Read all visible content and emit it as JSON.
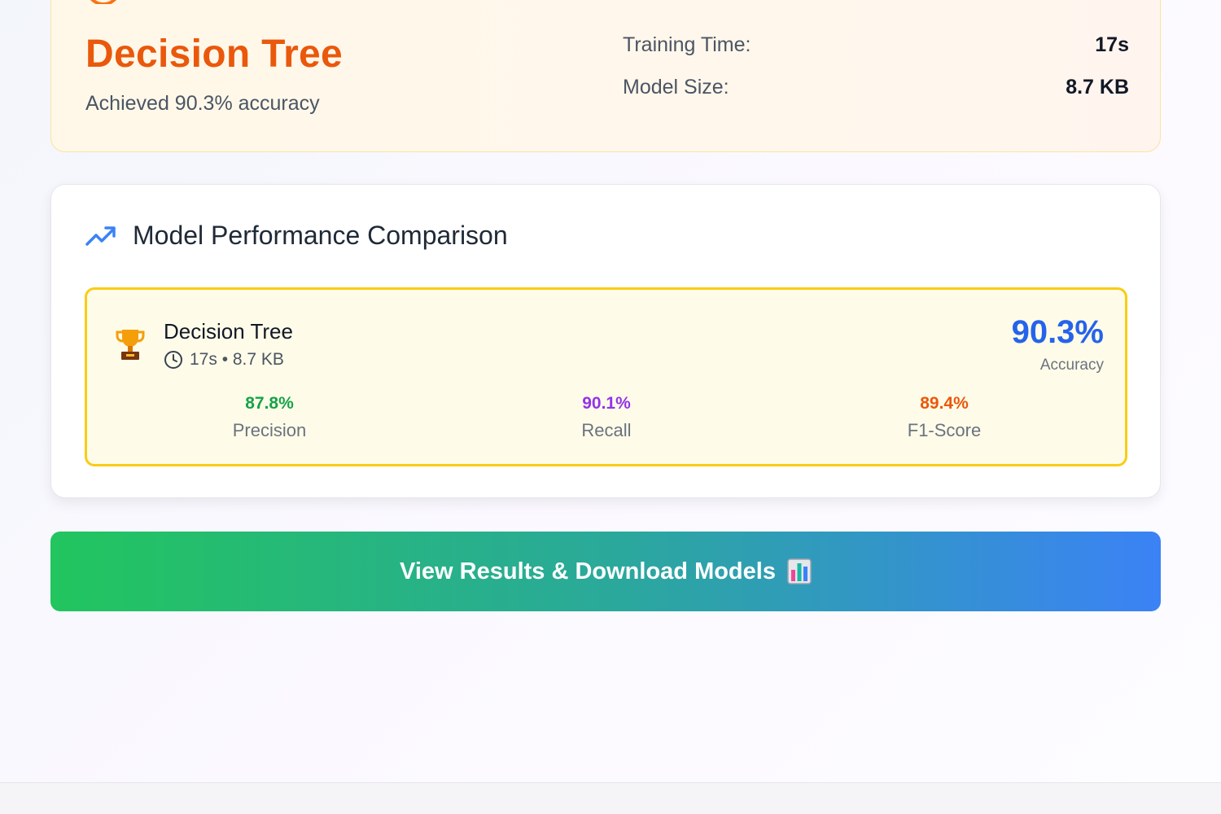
{
  "best_model": {
    "title": "Decision Tree",
    "subtitle": "Achieved 90.3% accuracy",
    "stats": [
      {
        "label": "Training Time:",
        "value": "17s"
      },
      {
        "label": "Model Size:",
        "value": "8.7 KB"
      }
    ]
  },
  "comparison": {
    "title": "Model Performance Comparison",
    "icon": "trending-up-icon",
    "models": [
      {
        "name": "Decision Tree",
        "meta": "17s • 8.7 KB",
        "accuracy": "90.3%",
        "accuracy_label": "Accuracy",
        "metrics": [
          {
            "value": "87.8%",
            "label": "Precision",
            "color": "#16a34a"
          },
          {
            "value": "90.1%",
            "label": "Recall",
            "color": "#9333ea"
          },
          {
            "value": "89.4%",
            "label": "F1-Score",
            "color": "#ea580c"
          }
        ]
      }
    ]
  },
  "cta": {
    "label": "View Results & Download Models",
    "icon": "bar-chart-icon"
  },
  "colors": {
    "accent_orange": "#ea580c",
    "accent_blue": "#2563eb",
    "highlight_border": "#facc15",
    "cta_start": "#22c55e",
    "cta_end": "#3b82f6"
  }
}
